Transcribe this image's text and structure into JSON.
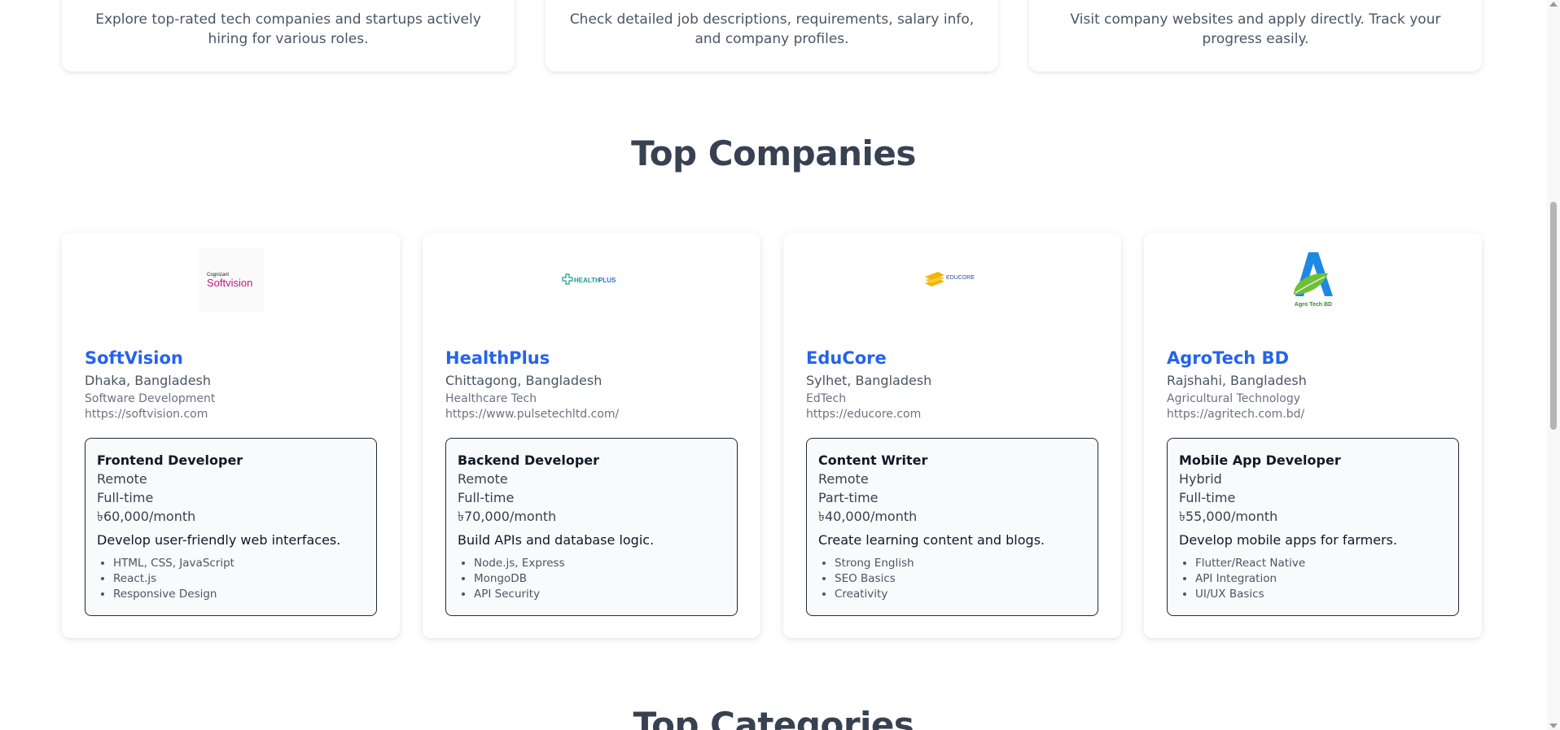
{
  "features": [
    {
      "text": "Explore top-rated tech companies and startups actively hiring for various roles."
    },
    {
      "text": "Check detailed job descriptions, requirements, salary info, and company profiles."
    },
    {
      "text": "Visit company websites and apply directly. Track your progress easily."
    }
  ],
  "sections": {
    "top_companies": "Top Companies",
    "next_partial": "Top Categories"
  },
  "companies": [
    {
      "name": "SoftVision",
      "location": "Dhaka, Bangladesh",
      "industry": "Software Development",
      "url": "https://softvision.com",
      "logo": {
        "top": "Cognizant",
        "main": "Softvision",
        "color": "#c0168a"
      },
      "job": {
        "title": "Frontend Developer",
        "mode": "Remote",
        "type": "Full-time",
        "salary": "৳60,000/month",
        "description": "Develop user-friendly web interfaces.",
        "skills": [
          "HTML, CSS, JavaScript",
          "React.js",
          "Responsive Design"
        ]
      }
    },
    {
      "name": "HealthPlus",
      "location": "Chittagong, Bangladesh",
      "industry": "Healthcare Tech",
      "url": "https://www.pulsetechltd.com/",
      "logo": {
        "main_a": "HEALTH",
        "main_b": "PLUS",
        "color": "#1a9c8c"
      },
      "job": {
        "title": "Backend Developer",
        "mode": "Remote",
        "type": "Full-time",
        "salary": "৳70,000/month",
        "description": "Build APIs and database logic.",
        "skills": [
          "Node.js, Express",
          "MongoDB",
          "API Security"
        ]
      }
    },
    {
      "name": "EduCore",
      "location": "Sylhet, Bangladesh",
      "industry": "EdTech",
      "url": "https://educore.com",
      "logo": {
        "main": "EDUCORE",
        "color": "#f4b400"
      },
      "job": {
        "title": "Content Writer",
        "mode": "Remote",
        "type": "Part-time",
        "salary": "৳40,000/month",
        "description": "Create learning content and blogs.",
        "skills": [
          "Strong English",
          "SEO Basics",
          "Creativity"
        ]
      }
    },
    {
      "name": "AgroTech BD",
      "location": "Rajshahi, Bangladesh",
      "industry": "Agricultural Technology",
      "url": "https://agritech.com.bd/",
      "logo": {
        "main": "Agro Tech BD",
        "color": "#1e88e5"
      },
      "job": {
        "title": "Mobile App Developer",
        "mode": "Hybrid",
        "type": "Full-time",
        "salary": "৳55,000/month",
        "description": "Develop mobile apps for farmers.",
        "skills": [
          "Flutter/React Native",
          "API Integration",
          "UI/UX Basics"
        ]
      }
    }
  ],
  "colors": {
    "accent": "#2563eb",
    "heading": "#374151"
  }
}
